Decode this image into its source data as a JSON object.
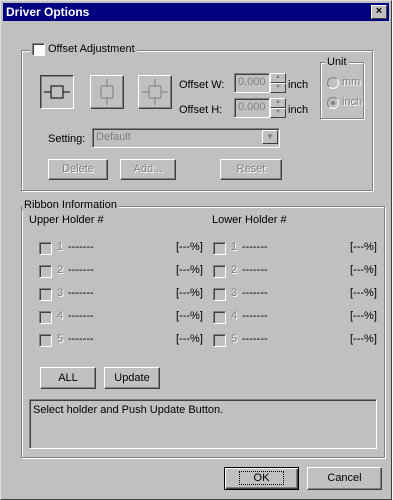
{
  "window": {
    "title": "Driver Options",
    "close_label": "×"
  },
  "offset": {
    "legend": "Offset Adjustment",
    "offset_w_label": "Offset W:",
    "offset_w_value": "0.000",
    "offset_h_label": "Offset H:",
    "offset_h_value": "0.000",
    "unit_suffix": "inch",
    "unit_group": {
      "legend": "Unit",
      "mm_label": "mm",
      "inch_label": "inch",
      "selected": "inch"
    },
    "setting_label": "Setting:",
    "setting_value": "Default",
    "buttons": {
      "delete": "Delete",
      "add": "Add...",
      "reset": "Reset"
    },
    "position_icons": [
      "horizontal-offset-icon",
      "vertical-offset-icon",
      "both-offset-icon"
    ]
  },
  "ribbon": {
    "legend": "Ribbon Information",
    "upper_header": "Upper Holder #",
    "lower_header": "Lower Holder #",
    "upper": [
      {
        "num": "1",
        "name": "-------",
        "pct": "[---%]"
      },
      {
        "num": "2",
        "name": "-------",
        "pct": "[---%]"
      },
      {
        "num": "3",
        "name": "-------",
        "pct": "[---%]"
      },
      {
        "num": "4",
        "name": "-------",
        "pct": "[---%]"
      },
      {
        "num": "5",
        "name": "-------",
        "pct": "[---%]"
      }
    ],
    "lower": [
      {
        "num": "1",
        "name": "-------",
        "pct": "[---%]"
      },
      {
        "num": "2",
        "name": "-------",
        "pct": "[---%]"
      },
      {
        "num": "3",
        "name": "-------",
        "pct": "[---%]"
      },
      {
        "num": "4",
        "name": "-------",
        "pct": "[---%]"
      },
      {
        "num": "5",
        "name": "-------",
        "pct": "[---%]"
      }
    ],
    "all_label": "ALL",
    "update_label": "Update",
    "status_text": "Select holder and Push Update Button."
  },
  "footer": {
    "ok_label": "OK",
    "cancel_label": "Cancel"
  }
}
